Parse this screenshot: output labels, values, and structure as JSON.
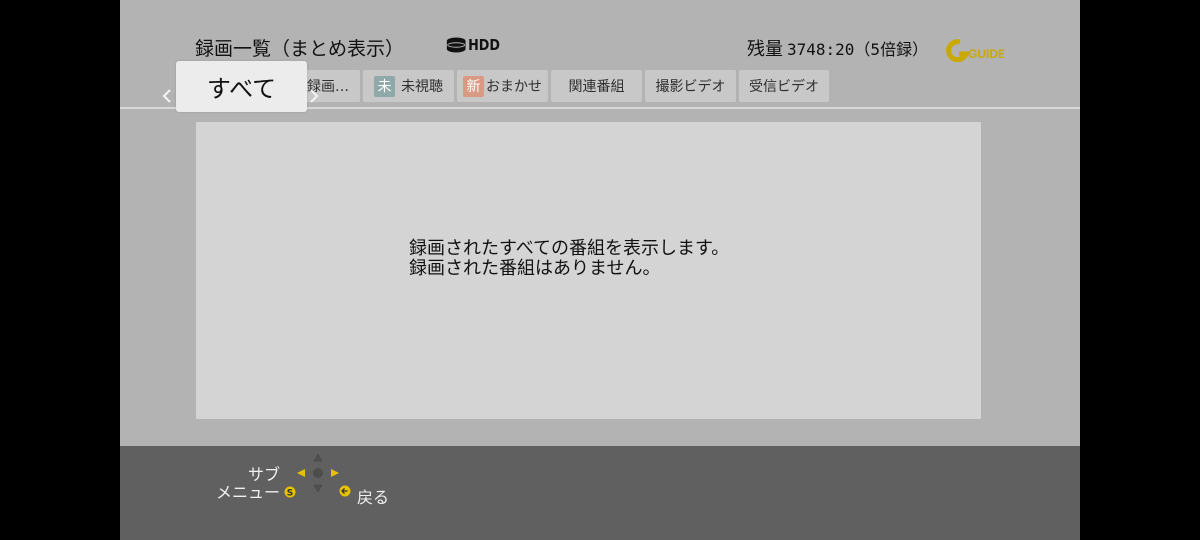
{
  "header": {
    "title": "録画一覧（まとめ表示）",
    "source_label": "HDD",
    "remaining_label": "残量",
    "remaining_value": "3748:20（5倍録）",
    "gguide_logo": "GUIDE"
  },
  "tabs": {
    "selected": "すべて",
    "items": [
      {
        "label": "最新録画…",
        "badge": ""
      },
      {
        "label": "未視聴",
        "badge": "未"
      },
      {
        "label": "おまかせ",
        "badge": "新"
      },
      {
        "label": "関連番組",
        "badge": ""
      },
      {
        "label": "撮影ビデオ",
        "badge": ""
      },
      {
        "label": "受信ビデオ",
        "badge": ""
      }
    ]
  },
  "message": {
    "line1": "録画されたすべての番組を表示します。",
    "line2": "録画された番組はありません。"
  },
  "footer": {
    "submenu_line1": "サブ",
    "submenu_line2": "メニュー",
    "back_label": "戻る"
  },
  "colors": {
    "badge_unwatched": "#8fa8a8",
    "badge_new": "#d99a84",
    "accent_yellow": "#e6c200"
  },
  "icons": {
    "hdd": "hdd-icon",
    "left": "chevron-left-icon",
    "right": "chevron-right-icon",
    "submenu_button": "s-button-icon",
    "dpad": "dpad-icon",
    "back_button": "back-button-icon"
  }
}
